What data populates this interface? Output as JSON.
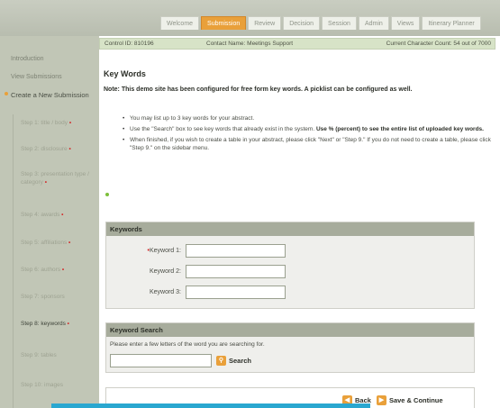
{
  "tabs": [
    "Welcome",
    "Submission",
    "Review",
    "Decision",
    "Session",
    "Admin",
    "Views",
    "Itinerary Planner"
  ],
  "active_tab_index": 1,
  "sidebar": {
    "links": [
      "Introduction",
      "View Submissions"
    ],
    "current_section": "Create a New Submission",
    "steps": [
      {
        "label": "Step 1: title / body",
        "required": true
      },
      {
        "label": "Step 2: disclosure",
        "required": true
      },
      {
        "label": "Step 3: presentation type / category",
        "required": true
      },
      {
        "label": "Step 4: awards",
        "required": true
      },
      {
        "label": "Step 5: affiliations",
        "required": true
      },
      {
        "label": "Step 6: authors",
        "required": true
      },
      {
        "label": "Step 7: sponsors",
        "required": false
      },
      {
        "label": "Step 8: keywords",
        "required": true
      },
      {
        "label": "Step 9: tables",
        "required": false
      },
      {
        "label": "Step 10: images",
        "required": false
      }
    ],
    "active_step_index": 7
  },
  "infobar": {
    "control_id": "Control ID: 810196",
    "contact_name": "Contact Name: Meetings Support",
    "char_count": "Current Character Count: 54 out of 7000"
  },
  "page_title": "Key Words",
  "note": "Note: This demo site has been configured for free form key words. A picklist can be configured as well.",
  "bullets": [
    {
      "text": "You may list up to 3 key words for your abstract.",
      "bold": ""
    },
    {
      "text": "Use the \"Search\" box to see key words that already exist in the system.",
      "bold": "Use % (percent) to see the entire list of uploaded key words."
    },
    {
      "text": "When finished, if you wish to create a table in your abstract, please click \"Next\" or \"Step 9.\" If you do not need to create a table, please click \"Step 9.\" on the sidebar menu.",
      "bold": ""
    }
  ],
  "keywords": {
    "heading": "Keywords",
    "fields": [
      {
        "label": "Keyword 1:",
        "required": true,
        "value": ""
      },
      {
        "label": "Keyword 2:",
        "required": false,
        "value": ""
      },
      {
        "label": "Keyword 3:",
        "required": false,
        "value": ""
      }
    ]
  },
  "keyword_search": {
    "heading": "Keyword Search",
    "hint": "Please enter a few letters of the word you are searching for.",
    "value": "",
    "button": "Search"
  },
  "nav": {
    "back": "Back",
    "save": "Save & Continue"
  },
  "colors": {
    "accent": "#e9a03a",
    "sidebar": "#c1c6b6",
    "infobar": "#d7e3c7",
    "required": "#d22b2b",
    "bottom_bar": "#2aa7d0"
  }
}
